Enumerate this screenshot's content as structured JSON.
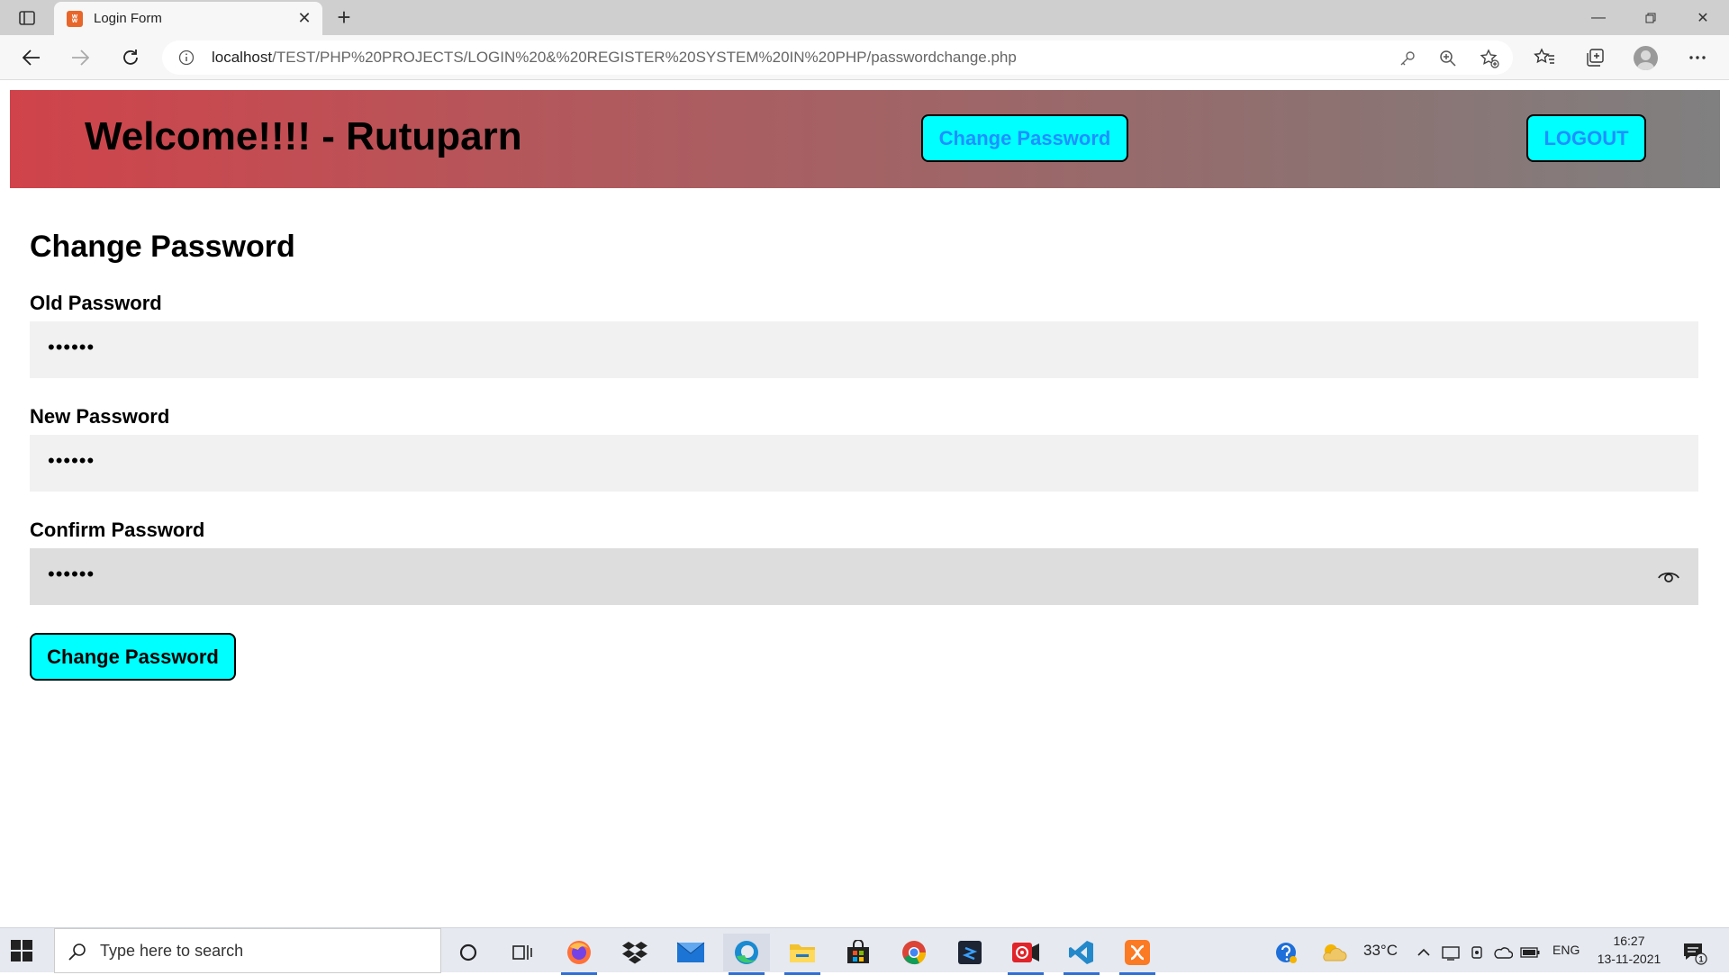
{
  "browser": {
    "tab_title": "Login Form",
    "url_host": "localhost",
    "url_path": "/TEST/PHP%20PROJECTS/LOGIN%20&%20REGISTER%20SYSTEM%20IN%20PHP/passwordchange.php"
  },
  "header": {
    "welcome": "Welcome!!!! - Rutuparn",
    "change_password_label": "Change Password",
    "logout_label": "LOGOUT"
  },
  "form": {
    "title": "Change Password",
    "old_password_label": "Old Password",
    "old_password_value": "••••••",
    "new_password_label": "New Password",
    "new_password_value": "••••••",
    "confirm_password_label": "Confirm Password",
    "confirm_password_value": "••••••",
    "submit_label": "Change Password"
  },
  "taskbar": {
    "search_placeholder": "Type here to search",
    "weather": "33°C",
    "language": "ENG",
    "time": "16:27",
    "date": "13-11-2021",
    "notification_count": "1"
  },
  "colors": {
    "header_gradient_start": "#d0434a",
    "header_gradient_end": "#808080",
    "button_bg": "#00ffff",
    "header_button_text": "#1e90ff"
  },
  "icons": [
    "tab-actions-icon",
    "xampp-favicon",
    "close-icon",
    "plus-icon",
    "minimize-icon",
    "restore-icon",
    "back-arrow-icon",
    "forward-arrow-icon",
    "refresh-icon",
    "info-icon",
    "key-icon",
    "zoom-icon",
    "add-favorite-icon",
    "favorites-icon",
    "collections-icon",
    "profile-avatar",
    "more-icon",
    "eye-icon",
    "windows-start-icon",
    "search-icon",
    "cortana-icon",
    "task-view-icon",
    "firefox-icon",
    "dropbox-icon",
    "mail-icon",
    "edge-icon",
    "file-explorer-icon",
    "store-icon",
    "chrome-icon",
    "sublime-icon",
    "recorder-icon",
    "vscode-icon",
    "xampp-icon",
    "help-icon",
    "weather-icon",
    "chevron-up-icon",
    "notification-icon"
  ]
}
